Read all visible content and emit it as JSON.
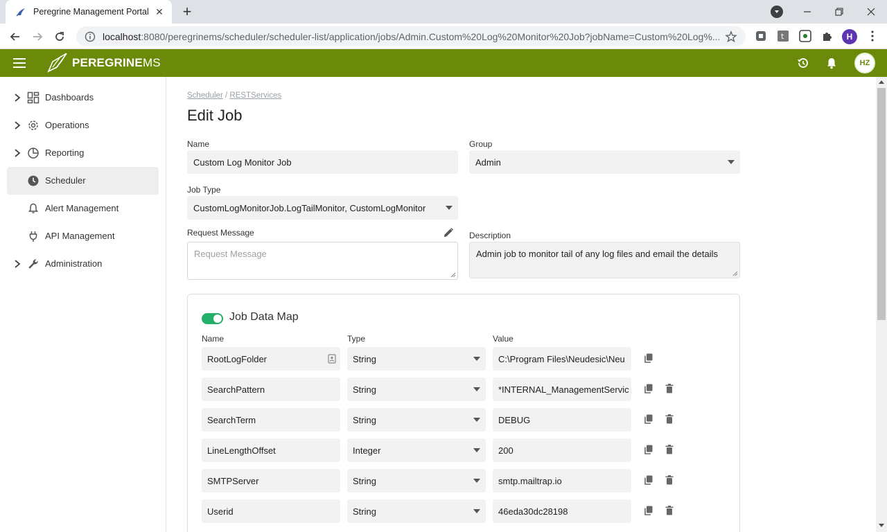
{
  "browser": {
    "tab_title": "Peregrine Management Portal",
    "url_host": "localhost",
    "url_rest": ":8080/peregrinems/scheduler/scheduler-list/application/jobs/Admin.Custom%20Log%20Monitor%20Job?jobName=Custom%20Log%...",
    "profile_initial": "H"
  },
  "app": {
    "brand_bold": "PEREGRINE",
    "brand_light": "MS",
    "avatar_initials": "HZ",
    "accent_color": "#6c8a09"
  },
  "sidebar": {
    "items": [
      {
        "label": "Dashboards",
        "icon": "dashboard-icon",
        "expandable": true
      },
      {
        "label": "Operations",
        "icon": "gear-icon",
        "expandable": true
      },
      {
        "label": "Reporting",
        "icon": "pie-chart-icon",
        "expandable": true
      },
      {
        "label": "Scheduler",
        "icon": "clock-icon",
        "expandable": false,
        "active": true
      },
      {
        "label": "Alert Management",
        "icon": "bell-icon",
        "expandable": false
      },
      {
        "label": "API Management",
        "icon": "plug-icon",
        "expandable": false
      },
      {
        "label": "Administration",
        "icon": "wrench-icon",
        "expandable": true
      }
    ]
  },
  "breadcrumb": {
    "first": "Scheduler",
    "separator": " / ",
    "second": "RESTServices"
  },
  "page_title": "Edit Job",
  "form": {
    "name_label": "Name",
    "name_value": "Custom Log Monitor Job",
    "group_label": "Group",
    "group_value": "Admin",
    "job_type_label": "Job Type",
    "job_type_value": "CustomLogMonitorJob.LogTailMonitor, CustomLogMonitor",
    "request_label": "Request Message",
    "request_placeholder": "Request Message",
    "description_label": "Description",
    "description_value": "Admin job to monitor tail of any log files and email the details"
  },
  "job_data_map": {
    "title": "Job Data Map",
    "enabled": true,
    "col_name": "Name",
    "col_type": "Type",
    "col_value": "Value",
    "rows": [
      {
        "name": "RootLogFolder",
        "type": "String",
        "value": "C:\\Program Files\\Neudesic\\Neu",
        "deletable": false
      },
      {
        "name": "SearchPattern",
        "type": "String",
        "value": "*INTERNAL_ManagementServic",
        "deletable": true
      },
      {
        "name": "SearchTerm",
        "type": "String",
        "value": "DEBUG",
        "deletable": true
      },
      {
        "name": "LineLengthOffset",
        "type": "Integer",
        "value": "200",
        "deletable": true
      },
      {
        "name": "SMTPServer",
        "type": "String",
        "value": "smtp.mailtrap.io",
        "deletable": true
      },
      {
        "name": "Userid",
        "type": "String",
        "value": "46eda30dc28198",
        "deletable": true
      }
    ]
  }
}
